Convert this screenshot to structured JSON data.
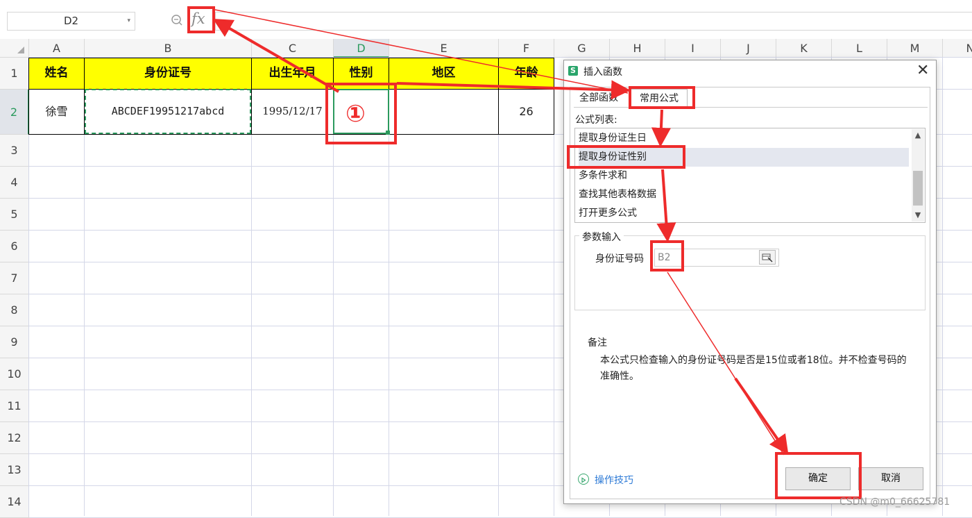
{
  "formula_bar": {
    "name_box": "D2",
    "fx_label": "fx"
  },
  "columns": [
    "A",
    "B",
    "C",
    "D",
    "E",
    "F",
    "G",
    "H",
    "I",
    "J",
    "K",
    "L",
    "M",
    "N"
  ],
  "rows": [
    "1",
    "2",
    "3",
    "4",
    "5",
    "6",
    "7",
    "8",
    "9",
    "10",
    "11",
    "12",
    "13",
    "14"
  ],
  "table": {
    "headers": [
      "姓名",
      "身份证号",
      "出生年月",
      "性别",
      "地区",
      "年龄"
    ],
    "row2": [
      "徐雪",
      "ABCDEF19951217abcd",
      "1995/12/17",
      "",
      "",
      "26"
    ]
  },
  "dialog": {
    "title": "插入函数",
    "tabs": [
      "全部函数",
      "常用公式"
    ],
    "list_label": "公式列表:",
    "formulas": [
      "提取身份证生日",
      "提取身份证性别",
      "多条件求和",
      "查找其他表格数据",
      "打开更多公式"
    ],
    "param_group_label": "参数输入",
    "param_field_label": "身份证号码",
    "param_value": "B2",
    "notes_label": "备注",
    "notes_text": "本公式只检查输入的身份证号码是否是15位或者18位。并不检查号码的准确性。",
    "tips_link": "操作技巧",
    "ok": "确定",
    "cancel": "取消"
  },
  "annotation": {
    "marker": "①"
  },
  "watermark": "CSDN @m0_66625781",
  "colors": {
    "accent": "#2b9a5e",
    "annotation_red": "#ee2b2b",
    "header_fill": "#ffff00"
  }
}
